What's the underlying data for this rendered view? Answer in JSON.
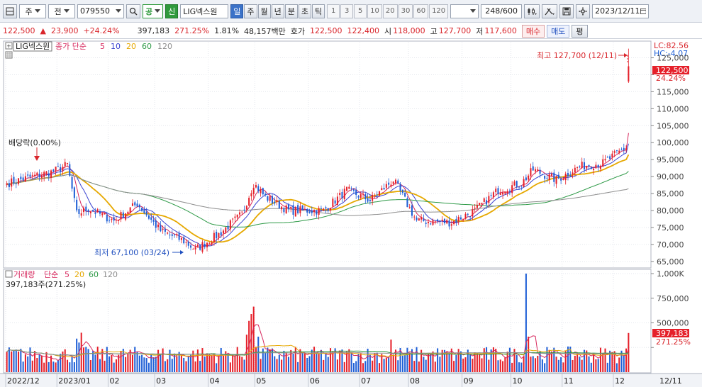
{
  "toolbar": {
    "market": "주",
    "type": "전",
    "code": "079550",
    "gong_label": "공",
    "sin_label": "신",
    "stock_name": "LIG넥스원",
    "tabs": [
      "일",
      "주",
      "월",
      "년",
      "분",
      "초",
      "틱"
    ],
    "active_tab": "일",
    "periods": [
      "1",
      "3",
      "5",
      "10",
      "20",
      "30",
      "60",
      "120"
    ],
    "count": "248",
    "count_total": "/600",
    "date": "2023/12/11"
  },
  "quote": {
    "price": "122,500",
    "change_arrow": "▲",
    "change": "23,900",
    "change_pct": "+24.24%",
    "volume": "397,183",
    "volume_ratio": "271.25%",
    "turnover": "1.81%",
    "amount": "48,157백만",
    "hoga_label": "호가",
    "ask": "122,500",
    "bid": "122,400",
    "open_label": "시",
    "open": "118,000",
    "high_label": "고",
    "high": "127,700",
    "low_label": "저",
    "low": "117,600",
    "buy_label": "매수",
    "sell_label": "매도",
    "eval_label": "평"
  },
  "legend_price": {
    "name": "LIG넥스원",
    "ma_label": "종가 단순",
    "periods": [
      "5",
      "10",
      "20",
      "60",
      "120"
    ],
    "colors": [
      "#d7275d",
      "#3a43d0",
      "#e6a800",
      "#2e9a47",
      "#8d8d8d"
    ]
  },
  "legend_volume": {
    "name": "거래량",
    "ma_label": "단순",
    "periods": [
      "5",
      "20",
      "60",
      "120"
    ],
    "colors": [
      "#d7275d",
      "#e6a800",
      "#2e9a47",
      "#8d8d8d"
    ],
    "current": "397,183주(271.25%)"
  },
  "axis_right": {
    "lc": "LC:82.56",
    "hc": "HC:-4.07",
    "price_ticks": [
      "125,000",
      "120,000",
      "115,000",
      "110,000",
      "105,000",
      "100,000",
      "95,000",
      "90,000",
      "85,000",
      "80,000",
      "75,000",
      "70,000",
      "65,000"
    ],
    "current_price": "122,500",
    "current_pct": "24.24%",
    "volume_ticks": [
      "1,000K",
      "750,000",
      "500,000",
      "250,000"
    ],
    "current_volume": "397,183",
    "current_volume_pct": "271.25%"
  },
  "annotations": {
    "high": "최고 127,700 (12/11)",
    "low": "최저 67,100 (03/24)",
    "dividend": "배당락(0.00%)"
  },
  "x_labels": [
    "2022/12",
    "2023/01",
    "02",
    "03",
    "04",
    "05",
    "06",
    "07",
    "08",
    "09",
    "10",
    "11",
    "12",
    "12/11"
  ],
  "colors": {
    "up": "#e5202a",
    "down": "#1f5fd6",
    "grid": "#e3e6ec"
  },
  "chart_data": {
    "type": "candlestick",
    "title": "LIG넥스원 (079550) 일봉",
    "price_ylim": [
      63500,
      129500
    ],
    "volume_ylim": [
      0,
      1000000
    ],
    "anchors": [
      {
        "date": "2022-12-01",
        "close": 88000
      },
      {
        "date": "2022-12-16",
        "close": 90000
      },
      {
        "date": "2022-12-29",
        "close": 91500
      },
      {
        "date": "2023-01-06",
        "close": 93500
      },
      {
        "date": "2023-01-12",
        "close": 79000
      },
      {
        "date": "2023-01-19",
        "close": 80500
      },
      {
        "date": "2023-02-03",
        "close": 77000
      },
      {
        "date": "2023-02-17",
        "close": 82000
      },
      {
        "date": "2023-03-03",
        "close": 74000
      },
      {
        "date": "2023-03-17",
        "close": 71000
      },
      {
        "date": "2023-03-24",
        "close": 68500
      },
      {
        "date": "2023-04-07",
        "close": 73000
      },
      {
        "date": "2023-04-21",
        "close": 79000
      },
      {
        "date": "2023-04-28",
        "close": 88000
      },
      {
        "date": "2023-05-05",
        "close": 84000
      },
      {
        "date": "2023-05-19",
        "close": 80000
      },
      {
        "date": "2023-06-09",
        "close": 80000
      },
      {
        "date": "2023-06-23",
        "close": 86000
      },
      {
        "date": "2023-07-07",
        "close": 83000
      },
      {
        "date": "2023-07-21",
        "close": 89000
      },
      {
        "date": "2023-08-04",
        "close": 77000
      },
      {
        "date": "2023-08-25",
        "close": 76500
      },
      {
        "date": "2023-09-08",
        "close": 80000
      },
      {
        "date": "2023-09-22",
        "close": 86000
      },
      {
        "date": "2023-10-06",
        "close": 88000
      },
      {
        "date": "2023-10-13",
        "close": 92000
      },
      {
        "date": "2023-10-27",
        "close": 89000
      },
      {
        "date": "2023-11-10",
        "close": 93000
      },
      {
        "date": "2023-11-24",
        "close": 94000
      },
      {
        "date": "2023-12-08",
        "close": 98600
      },
      {
        "date": "2023-12-11",
        "close": 122500
      }
    ],
    "last_candle": {
      "date": "2023-12-11",
      "open": 118000,
      "high": 127700,
      "low": 117600,
      "close": 122500,
      "volume": 397183
    },
    "period_high": {
      "date": "2023-12-11",
      "value": 127700
    },
    "period_low": {
      "date": "2023-03-24",
      "value": 67100
    },
    "dividend": {
      "date": "2023-01-06"
    },
    "volume_spikes": [
      {
        "date": "2023-01-16",
        "value": 400000
      },
      {
        "date": "2023-04-28",
        "value": 665000
      },
      {
        "date": "2023-04-27",
        "value": 590000
      },
      {
        "date": "2023-10-10",
        "value": 1000000
      },
      {
        "date": "2023-12-11",
        "value": 397183
      }
    ]
  }
}
